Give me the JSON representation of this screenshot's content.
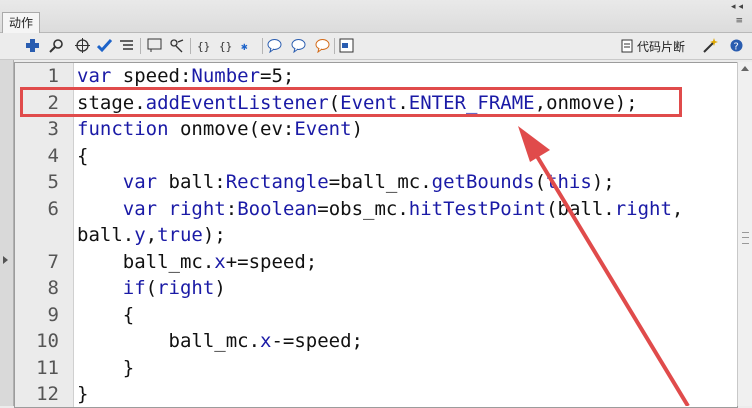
{
  "panel": {
    "tab_label": "动作"
  },
  "toolbar": {
    "icons": [
      "add-statement-icon",
      "find-icon",
      "target-icon",
      "check-syntax-icon",
      "auto-format-icon",
      "code-hint-icon",
      "debug-options-icon",
      "collapse-between-braces-icon",
      "collapse-selection-icon",
      "expand-all-icon",
      "apply-block-comment-icon",
      "apply-line-comment-icon",
      "remove-comment-icon",
      "show-hide-toolbox-icon"
    ],
    "snippets_label": "代码片断"
  },
  "editor": {
    "lines": [
      {
        "n": "1",
        "text": "var speed:Number=5;"
      },
      {
        "n": "2",
        "text": "stage.addEventListener(Event.ENTER_FRAME,onmove);"
      },
      {
        "n": "3",
        "text": "function onmove(ev:Event)"
      },
      {
        "n": "4",
        "text": "{"
      },
      {
        "n": "5",
        "text": "    var ball:Rectangle=ball_mc.getBounds(this);"
      },
      {
        "n": "6",
        "text": "    var right:Boolean=obs_mc.hitTestPoint(ball.right,"
      },
      {
        "n": "",
        "text": "ball.y,true);"
      },
      {
        "n": "7",
        "text": "    ball_mc.x+=speed;"
      },
      {
        "n": "8",
        "text": "    if(right)"
      },
      {
        "n": "9",
        "text": "    {"
      },
      {
        "n": "10",
        "text": "        ball_mc.x-=speed;"
      },
      {
        "n": "11",
        "text": "    }"
      },
      {
        "n": "12",
        "text": "}"
      }
    ]
  },
  "colors": {
    "keyword": "#1a1aa6",
    "annotation": "#e04b4b"
  }
}
